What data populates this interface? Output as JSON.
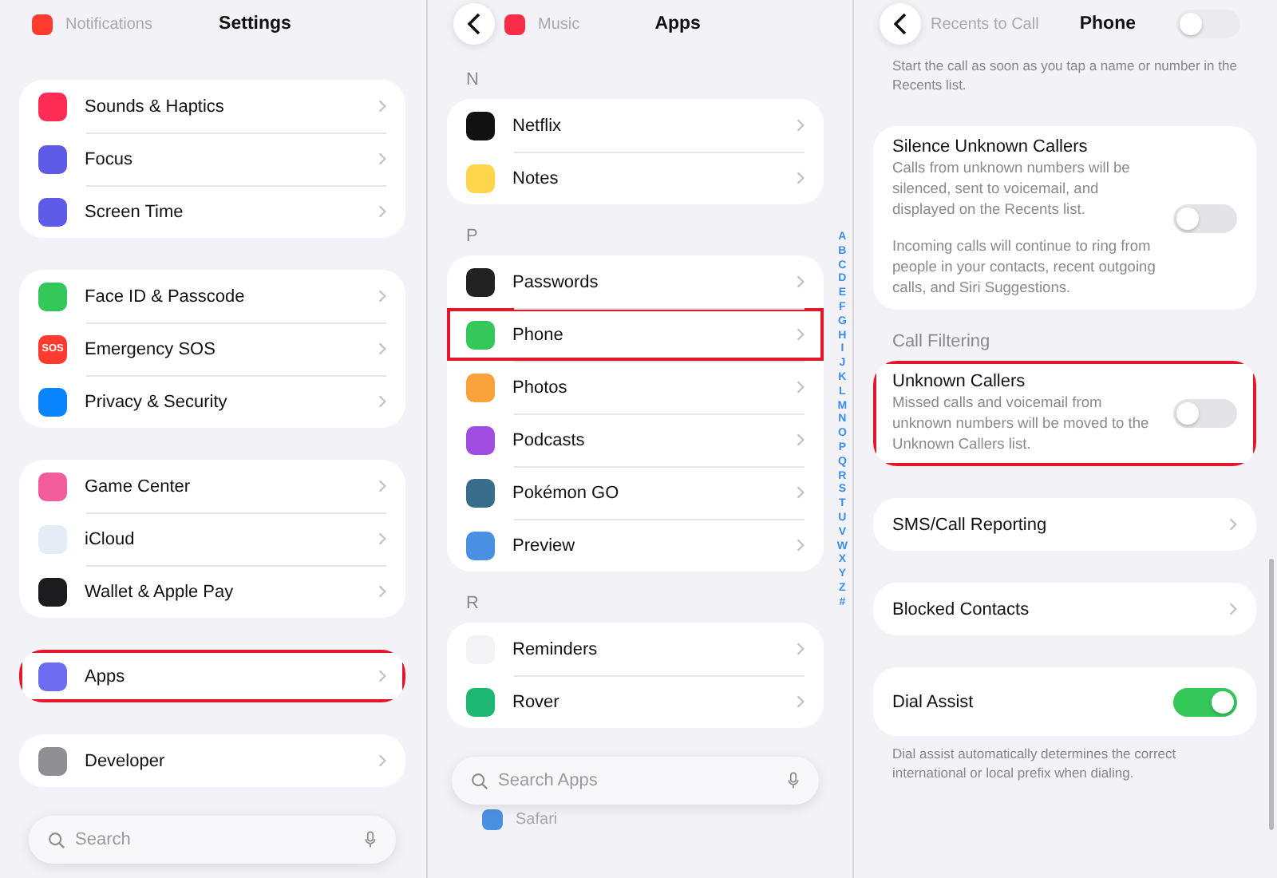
{
  "panels": [
    {
      "top_row": {
        "label": "Notifications",
        "color": "#ff3b30"
      },
      "title": "Settings",
      "groups": [
        {
          "items": [
            {
              "kind": "app",
              "label": "Sounds & Haptics",
              "color": "#ff2d55",
              "highlighted": false
            },
            {
              "kind": "app",
              "label": "Focus",
              "color": "#5e5ce6",
              "highlighted": false
            },
            {
              "kind": "app",
              "label": "Screen Time",
              "color": "#5e5ce6",
              "highlighted": false
            }
          ]
        },
        {
          "items": [
            {
              "kind": "app",
              "label": "Face ID & Passcode",
              "color": "#34c759",
              "highlighted": false
            },
            {
              "kind": "app",
              "label": "Emergency SOS",
              "color": "#ff3b30",
              "icon_text": "SOS",
              "highlighted": false
            },
            {
              "kind": "app",
              "label": "Privacy & Security",
              "color": "#0a84ff",
              "highlighted": false
            }
          ]
        },
        {
          "items": [
            {
              "kind": "app",
              "label": "Game Center",
              "color": "#f25c9a",
              "highlighted": false
            },
            {
              "kind": "app",
              "label": "iCloud",
              "color": "#e4ecf6",
              "highlighted": false
            },
            {
              "kind": "app",
              "label": "Wallet & Apple Pay",
              "color": "#1c1c1e",
              "highlighted": false
            }
          ]
        },
        {
          "items": [
            {
              "kind": "app",
              "label": "Apps",
              "color": "#6e6cf0",
              "highlighted": true
            }
          ]
        },
        {
          "items": [
            {
              "kind": "app",
              "label": "Developer",
              "color": "#8e8e93",
              "highlighted": false
            }
          ]
        }
      ],
      "search": {
        "placeholder": "Search"
      }
    },
    {
      "back_button": true,
      "top_row": {
        "label": "Music",
        "color": "#fa2d48"
      },
      "title": "Apps",
      "groups": [
        {
          "header": "N",
          "items": [
            {
              "kind": "app",
              "label": "Netflix",
              "color": "#111111",
              "highlighted": false
            },
            {
              "kind": "app",
              "label": "Notes",
              "color": "#ffd54a",
              "highlighted": false
            }
          ]
        },
        {
          "header": "P",
          "items": [
            {
              "kind": "app",
              "label": "Passwords",
              "color": "#222222",
              "highlighted": false
            },
            {
              "kind": "app",
              "label": "Phone",
              "color": "#34c759",
              "highlighted": true
            },
            {
              "kind": "app",
              "label": "Photos",
              "color": "#f7a23b",
              "highlighted": false
            },
            {
              "kind": "app",
              "label": "Podcasts",
              "color": "#a04ce0",
              "highlighted": false
            },
            {
              "kind": "app",
              "label": "Pokémon GO",
              "color": "#3a6d8c",
              "highlighted": false
            },
            {
              "kind": "app",
              "label": "Preview",
              "color": "#4a90e2",
              "highlighted": false
            }
          ]
        },
        {
          "header": "R",
          "items": [
            {
              "kind": "app",
              "label": "Reminders",
              "color": "#f4f4f6",
              "highlighted": false
            },
            {
              "kind": "app",
              "label": "Rover",
              "color": "#1db673",
              "highlighted": false
            }
          ]
        }
      ],
      "search": {
        "placeholder": "Search Apps"
      },
      "below_search": {
        "label": "Safari",
        "color": "#4a90e2"
      },
      "index": [
        "A",
        "B",
        "C",
        "D",
        "E",
        "F",
        "G",
        "H",
        "I",
        "J",
        "K",
        "L",
        "M",
        "N",
        "O",
        "P",
        "Q",
        "R",
        "S",
        "T",
        "U",
        "V",
        "W",
        "X",
        "Y",
        "Z",
        "#"
      ]
    },
    {
      "back_button": true,
      "top_row": {
        "label": "Recents to Call",
        "on": false
      },
      "title": "Phone",
      "top_footer": "Start the call as soon as you tap a name or number in the Recents list.",
      "groups": [
        {
          "items": [
            {
              "kind": "toggle",
              "label": "Silence Unknown Callers",
              "description": [
                "Calls from unknown numbers will be silenced, sent to voicemail, and displayed on the Recents list.",
                "Incoming calls will continue to ring from people in your contacts, recent outgoing calls, and Siri Suggestions."
              ],
              "on": false,
              "highlighted": false
            }
          ]
        },
        {
          "header": "Call Filtering",
          "items": [
            {
              "kind": "toggle",
              "label": "Unknown Callers",
              "description": [
                "Missed calls and voicemail from unknown numbers will be moved to the Unknown Callers list."
              ],
              "on": false,
              "highlighted": true
            }
          ]
        },
        {
          "items": [
            {
              "kind": "nav",
              "label": "SMS/Call Reporting",
              "highlighted": false
            }
          ]
        },
        {
          "items": [
            {
              "kind": "nav",
              "label": "Blocked Contacts",
              "highlighted": false
            }
          ]
        },
        {
          "items": [
            {
              "kind": "toggle",
              "label": "Dial Assist",
              "on": true,
              "highlighted": false
            }
          ],
          "footer": "Dial assist automatically determines the correct international or local prefix when dialing."
        }
      ]
    }
  ]
}
